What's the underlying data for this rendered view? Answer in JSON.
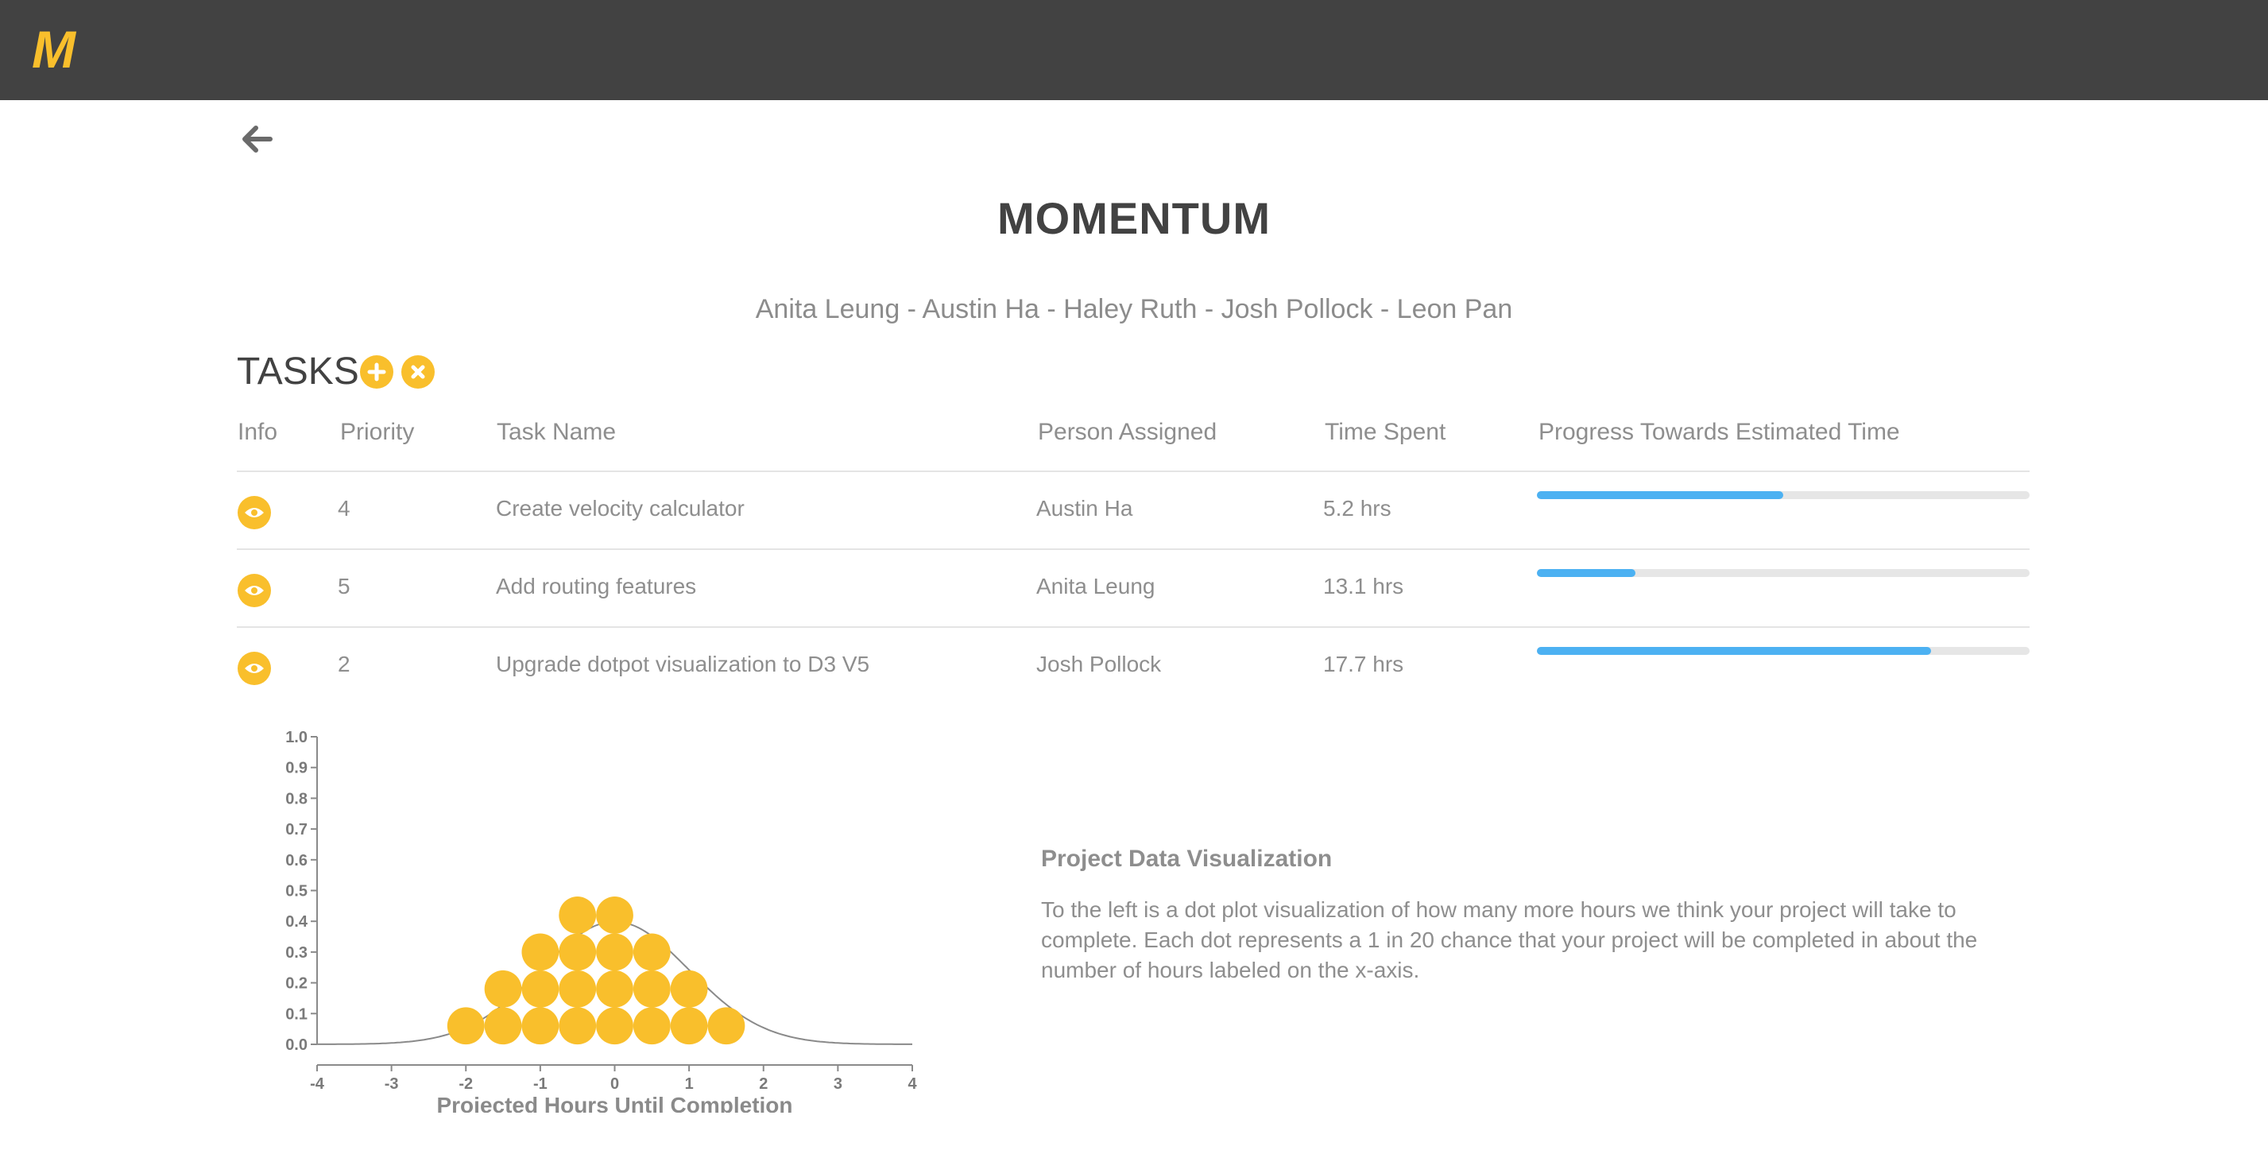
{
  "app": {
    "logo": "M",
    "brand_color": "#f9bf2c",
    "header_color": "#424242"
  },
  "nav": {
    "back_icon": "arrow-left-icon"
  },
  "project": {
    "title": "MOMENTUM",
    "members": "Anita Leung - Austin Ha - Haley Ruth - Josh Pollock - Leon Pan"
  },
  "tasks": {
    "heading": "TASKS",
    "add_icon": "plus-icon",
    "remove_icon": "close-icon",
    "columns": {
      "info": "Info",
      "priority": "Priority",
      "task_name": "Task Name",
      "person": "Person Assigned",
      "time": "Time Spent",
      "progress": "Progress Towards Estimated Time"
    },
    "rows": [
      {
        "info_icon": "eye-icon",
        "priority": "4",
        "name": "Create velocity calculator",
        "person": "Austin Ha",
        "time": "5.2 hrs",
        "progress": 0.5
      },
      {
        "info_icon": "eye-icon",
        "priority": "5",
        "name": "Add routing features",
        "person": "Anita Leung",
        "time": "13.1 hrs",
        "progress": 0.2
      },
      {
        "info_icon": "eye-icon",
        "priority": "2",
        "name": "Upgrade dotpot visualization to D3 V5",
        "person": "Josh Pollock",
        "time": "17.7 hrs",
        "progress": 0.8
      }
    ],
    "progress_color": "#4cb1f2"
  },
  "visualization": {
    "title": "Project Data Visualization",
    "description": "To the left is a dot plot visualization of how many more hours we think your project will take to complete. Each dot represents a 1 in 20 chance that your project will be completed in about the number of hours labeled on the x-axis."
  },
  "chart_data": {
    "type": "scatter",
    "xlabel": "Projected Hours Until Completion",
    "ylabel": "",
    "xlim": [
      -4,
      4
    ],
    "ylim": [
      0,
      1.0
    ],
    "x_ticks": [
      "-4",
      "-3",
      "-2",
      "-1",
      "0",
      "1",
      "2",
      "3",
      "4"
    ],
    "y_ticks": [
      "0.0",
      "0.1",
      "0.2",
      "0.3",
      "0.4",
      "0.5",
      "0.6",
      "0.7",
      "0.8",
      "0.9",
      "1.0"
    ],
    "dot_color": "#f9bf2c",
    "dots": [
      {
        "x": -2.0,
        "y": 0.06
      },
      {
        "x": -1.5,
        "y": 0.06
      },
      {
        "x": -1.0,
        "y": 0.06
      },
      {
        "x": -0.5,
        "y": 0.06
      },
      {
        "x": 0.0,
        "y": 0.06
      },
      {
        "x": 0.5,
        "y": 0.06
      },
      {
        "x": 1.0,
        "y": 0.06
      },
      {
        "x": 1.5,
        "y": 0.06
      },
      {
        "x": -1.5,
        "y": 0.18
      },
      {
        "x": -1.0,
        "y": 0.18
      },
      {
        "x": -0.5,
        "y": 0.18
      },
      {
        "x": 0.0,
        "y": 0.18
      },
      {
        "x": 0.5,
        "y": 0.18
      },
      {
        "x": 1.0,
        "y": 0.18
      },
      {
        "x": -1.0,
        "y": 0.3
      },
      {
        "x": -0.5,
        "y": 0.3
      },
      {
        "x": 0.0,
        "y": 0.3
      },
      {
        "x": 0.5,
        "y": 0.3
      },
      {
        "x": -0.5,
        "y": 0.42
      },
      {
        "x": 0.0,
        "y": 0.42
      }
    ],
    "curve": {
      "type": "normal",
      "mean": 0,
      "sd": 1
    },
    "grid": false
  }
}
